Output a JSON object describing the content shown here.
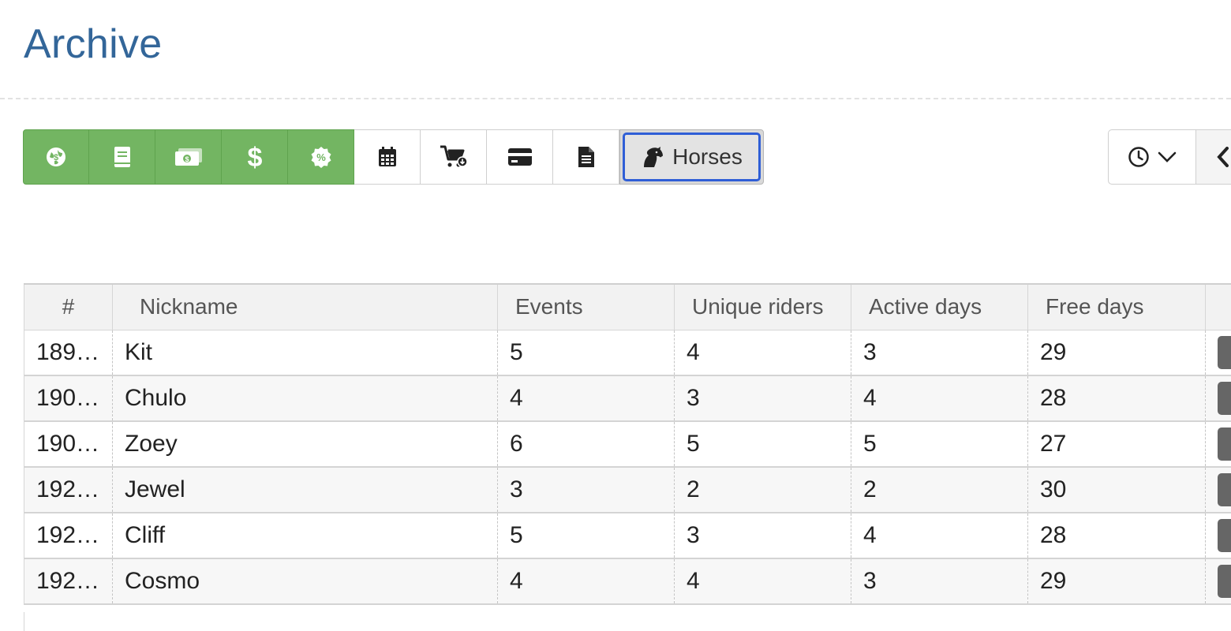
{
  "page": {
    "title": "Archive"
  },
  "toolbar": {
    "buttons": [
      {
        "icon": "globe-money-icon",
        "style": "green"
      },
      {
        "icon": "book-icon",
        "style": "green"
      },
      {
        "icon": "money-bill-icon",
        "style": "green"
      },
      {
        "icon": "dollar-icon",
        "style": "green"
      },
      {
        "icon": "percent-badge-icon",
        "style": "green"
      },
      {
        "icon": "calendar-icon",
        "style": "default"
      },
      {
        "icon": "cart-download-icon",
        "style": "default"
      },
      {
        "icon": "credit-card-icon",
        "style": "default"
      },
      {
        "icon": "document-icon",
        "style": "default"
      }
    ],
    "active_button": {
      "icon": "horse-icon",
      "label": "Horses"
    },
    "accent_green": "#73b562",
    "active_border": "#2f5ed6"
  },
  "controls": {
    "history_icon": "clock-icon",
    "dropdown_icon": "chevron-down-icon",
    "prev_icon": "chevron-left-icon"
  },
  "table": {
    "columns": [
      "#",
      "Nickname",
      "Events",
      "Unique riders",
      "Active days",
      "Free days"
    ],
    "rows": [
      {
        "id": "189…",
        "nickname": "Kit",
        "events": "5",
        "unique_riders": "4",
        "active_days": "3",
        "free_days": "29"
      },
      {
        "id": "190…",
        "nickname": "Chulo",
        "events": "4",
        "unique_riders": "3",
        "active_days": "4",
        "free_days": "28"
      },
      {
        "id": "190…",
        "nickname": "Zoey",
        "events": "6",
        "unique_riders": "5",
        "active_days": "5",
        "free_days": "27"
      },
      {
        "id": "192…",
        "nickname": "Jewel",
        "events": "3",
        "unique_riders": "2",
        "active_days": "2",
        "free_days": "30"
      },
      {
        "id": "192…",
        "nickname": "Cliff",
        "events": "5",
        "unique_riders": "3",
        "active_days": "4",
        "free_days": "28"
      },
      {
        "id": "192…",
        "nickname": "Cosmo",
        "events": "4",
        "unique_riders": "4",
        "active_days": "3",
        "free_days": "29"
      }
    ]
  }
}
